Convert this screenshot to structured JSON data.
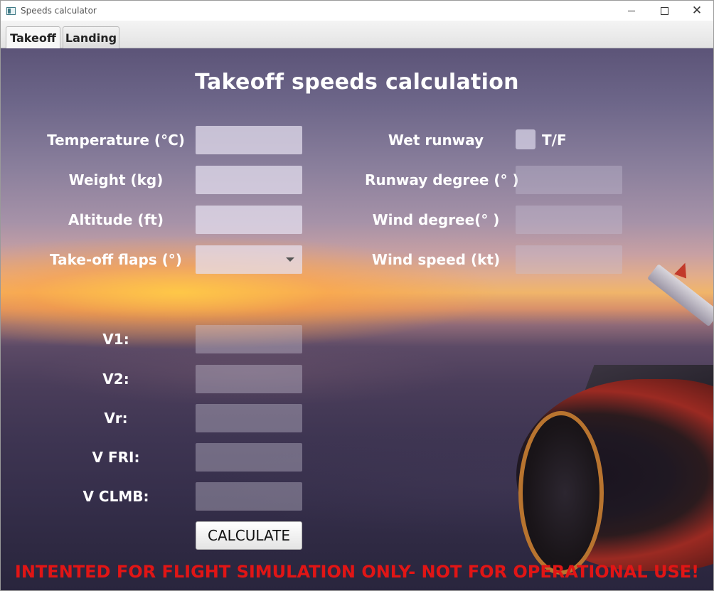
{
  "window": {
    "title": "Speeds calculator",
    "controls": {
      "minimize": "—",
      "maximize": "☐",
      "close": "✕"
    }
  },
  "tabs": [
    {
      "label": "Takeoff",
      "active": true
    },
    {
      "label": "Landing",
      "active": false
    }
  ],
  "form": {
    "title": "Takeoff speeds calculation",
    "inputs": {
      "temperature": {
        "label": "Temperature (°C)",
        "value": ""
      },
      "weight": {
        "label": "Weight (kg)",
        "value": ""
      },
      "altitude": {
        "label": "Altitude (ft)",
        "value": ""
      },
      "flaps": {
        "label": "Take-off flaps (°)",
        "value": ""
      },
      "wet_runway": {
        "label": "Wet runway",
        "checkbox_label": "T/F",
        "checked": false
      },
      "runway_degree": {
        "label": "Runway degree (° )",
        "value": ""
      },
      "wind_degree": {
        "label": "Wind degree(° )",
        "value": ""
      },
      "wind_speed": {
        "label": "Wind speed (kt)",
        "value": ""
      }
    },
    "outputs": {
      "v1": {
        "label": "V1:",
        "value": ""
      },
      "v2": {
        "label": "V2:",
        "value": ""
      },
      "vr": {
        "label": "Vr:",
        "value": ""
      },
      "vfri": {
        "label": "V FRI:",
        "value": ""
      },
      "vclmb": {
        "label": "V CLMB:",
        "value": ""
      }
    },
    "calculate_label": "CALCULATE",
    "warning": "INTENTED FOR FLIGHT SIMULATION ONLY- NOT FOR OPERATIONAL USE!"
  },
  "colors": {
    "warning": "#e11515",
    "label": "#ffffff"
  }
}
